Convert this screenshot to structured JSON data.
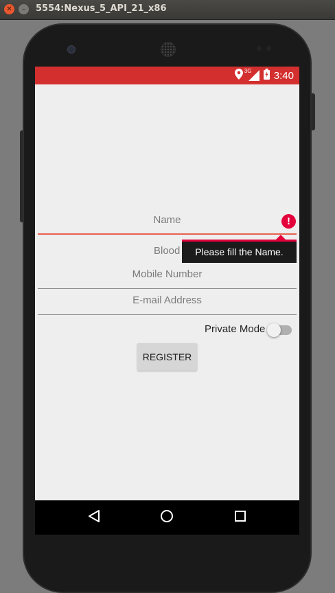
{
  "window": {
    "title": "5554:Nexus_5_API_21_x86"
  },
  "statusbar": {
    "time": "3:40",
    "network": "3G"
  },
  "form": {
    "name_placeholder": "Name",
    "blood_placeholder": "Blood",
    "mobile_placeholder": "Mobile Number",
    "email_placeholder": "E-mail Address",
    "error_message": "Please fill the Name.",
    "private_mode_label": "Private Mode",
    "private_mode_on": false,
    "register_label": "REGISTER"
  },
  "colors": {
    "status_bar": "#d32f2f",
    "error": "#e4003a",
    "error_underline": "#e8604f"
  },
  "icons": [
    "location-icon",
    "signal-icon",
    "battery-icon",
    "back-icon",
    "home-icon",
    "recents-icon",
    "error-icon"
  ]
}
